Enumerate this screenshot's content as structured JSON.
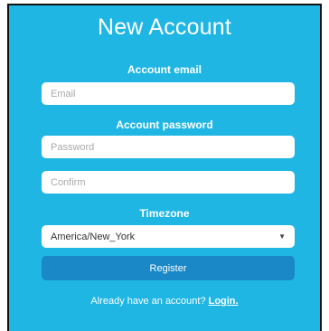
{
  "form": {
    "title": "New Account",
    "email_label": "Account email",
    "email_placeholder": "Email",
    "email_value": "",
    "password_label": "Account password",
    "password_placeholder": "Password",
    "password_value": "",
    "confirm_placeholder": "Confirm",
    "confirm_value": "",
    "timezone_label": "Timezone",
    "timezone_selected": "America/New_York",
    "register_label": "Register",
    "footer_text": "Already have an account?",
    "login_link": "Login."
  },
  "colors": {
    "panel_background": "#1fb6e3",
    "button_background": "#1a87c6",
    "text": "#ffffff"
  },
  "icons": {
    "select_arrow": "chevron-down-icon"
  }
}
